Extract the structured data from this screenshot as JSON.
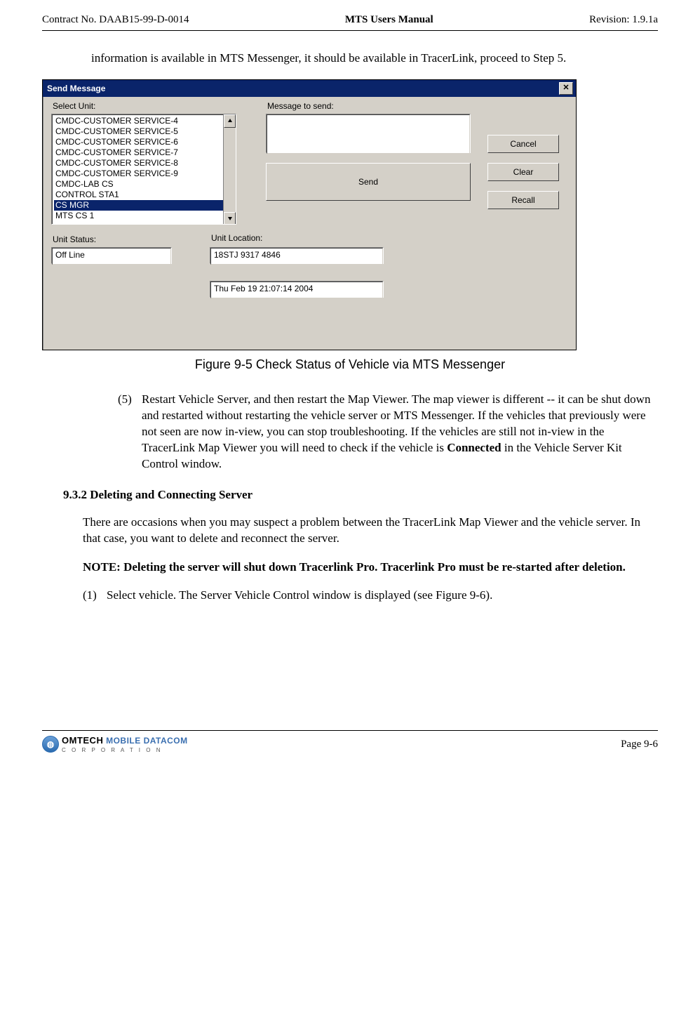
{
  "header": {
    "left": "Contract No. DAAB15-99-D-0014",
    "center": "MTS Users Manual",
    "right": "Revision:  1.9.1a"
  },
  "intro_para": "information is available in MTS Messenger, it should be available in TracerLink, proceed to Step 5.",
  "dialog": {
    "title": "Send Message",
    "close_glyph": "✕",
    "labels": {
      "select_unit": "Select Unit:",
      "message_to_send": "Message to send:",
      "unit_status": "Unit Status:",
      "unit_location": "Unit Location:"
    },
    "unit_list": [
      "CMDC-CUSTOMER SERVICE-4",
      "CMDC-CUSTOMER SERVICE-5",
      "CMDC-CUSTOMER SERVICE-6",
      "CMDC-CUSTOMER SERVICE-7",
      "CMDC-CUSTOMER SERVICE-8",
      "CMDC-CUSTOMER SERVICE-9",
      "CMDC-LAB CS",
      "CONTROL STA1",
      "CS MGR",
      "MTS CS 1"
    ],
    "unit_list_selected_index": 8,
    "buttons": {
      "send": "Send",
      "cancel": "Cancel",
      "clear": "Clear",
      "recall": "Recall"
    },
    "unit_status_value": "Off Line",
    "unit_location_value": "18STJ 9317 4846",
    "timestamp_value": "Thu Feb 19 21:07:14 2004"
  },
  "figure_caption": "Figure 9-5     Check Status of Vehicle via MTS Messenger",
  "list5": {
    "num": "(5)",
    "text_before": "Restart Vehicle Server, and then restart the Map Viewer.  The map viewer is different -- it can be shut down and restarted without restarting the vehicle server or MTS Messenger.  If the vehicles that previously were not seen are now in-view, you can stop troubleshooting.  If the vehicles are still not in-view in the TracerLink Map Viewer you will need to check if the vehicle is ",
    "bold": "Connected",
    "text_after": " in the Vehicle Server Kit Control window."
  },
  "section_heading": "9.3.2  Deleting and Connecting Server",
  "section_para": "There are occasions when you may suspect a problem between the TracerLink Map Viewer and the vehicle server.  In that case, you want to delete and reconnect the server.",
  "note_text": "NOTE: Deleting the server will shut down Tracerlink Pro. Tracerlink Pro must be re-started after deletion.",
  "list1": {
    "num": "(1)",
    "text": "Select vehicle.  The Server Vehicle Control window is displayed (see Figure 9-6)."
  },
  "footer": {
    "logo_globe": "◍",
    "logo_text1": "OMTECH",
    "logo_text2": "MOBILE DATACOM",
    "logo_sub": "C O R P O R A T I O N",
    "page": "Page 9-6"
  }
}
